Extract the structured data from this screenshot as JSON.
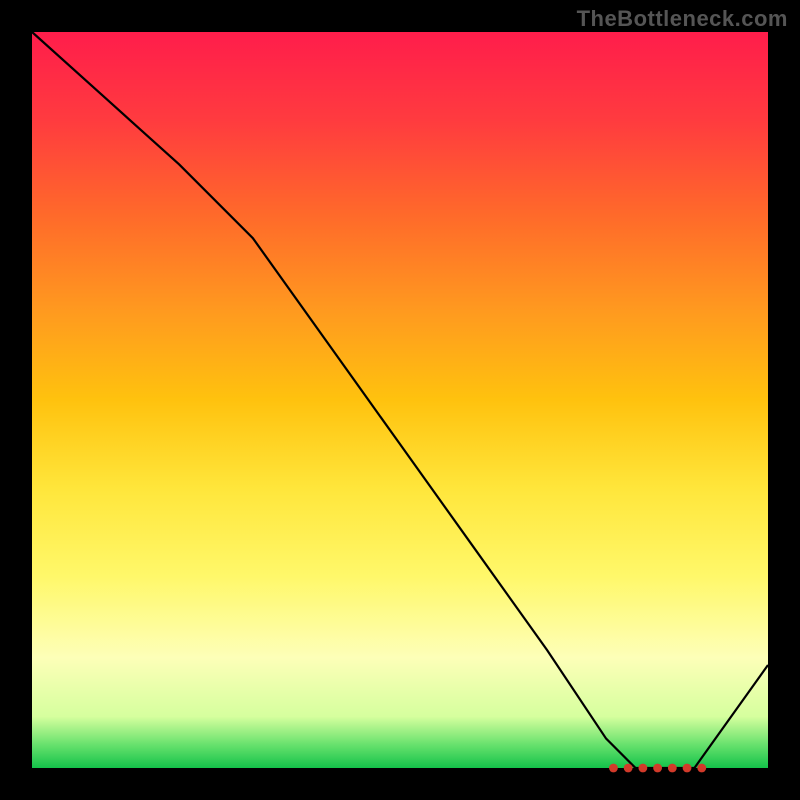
{
  "watermark": "TheBottleneck.com",
  "chart_data": {
    "type": "line",
    "title": "",
    "xlabel": "",
    "ylabel": "",
    "xlim": [
      0,
      100
    ],
    "ylim": [
      0,
      100
    ],
    "series": [
      {
        "name": "curve",
        "x": [
          0,
          10,
          20,
          30,
          40,
          50,
          60,
          70,
          78,
          82,
          86,
          90,
          100
        ],
        "y": [
          100,
          91,
          82,
          72,
          58,
          44,
          30,
          16,
          4,
          0,
          0,
          0,
          14
        ]
      }
    ],
    "markers": {
      "name": "highlight-cluster",
      "x": [
        79,
        81,
        83,
        85,
        87,
        89,
        91
      ],
      "y": [
        0,
        0,
        0,
        0,
        0,
        0,
        0
      ]
    },
    "gradient_stops": [
      {
        "pos": 0.0,
        "color": "#ff1d4b"
      },
      {
        "pos": 0.25,
        "color": "#ff6a2a"
      },
      {
        "pos": 0.5,
        "color": "#ffc20e"
      },
      {
        "pos": 0.75,
        "color": "#fff86a"
      },
      {
        "pos": 0.97,
        "color": "#63e06b"
      },
      {
        "pos": 1.0,
        "color": "#14c24a"
      }
    ]
  }
}
